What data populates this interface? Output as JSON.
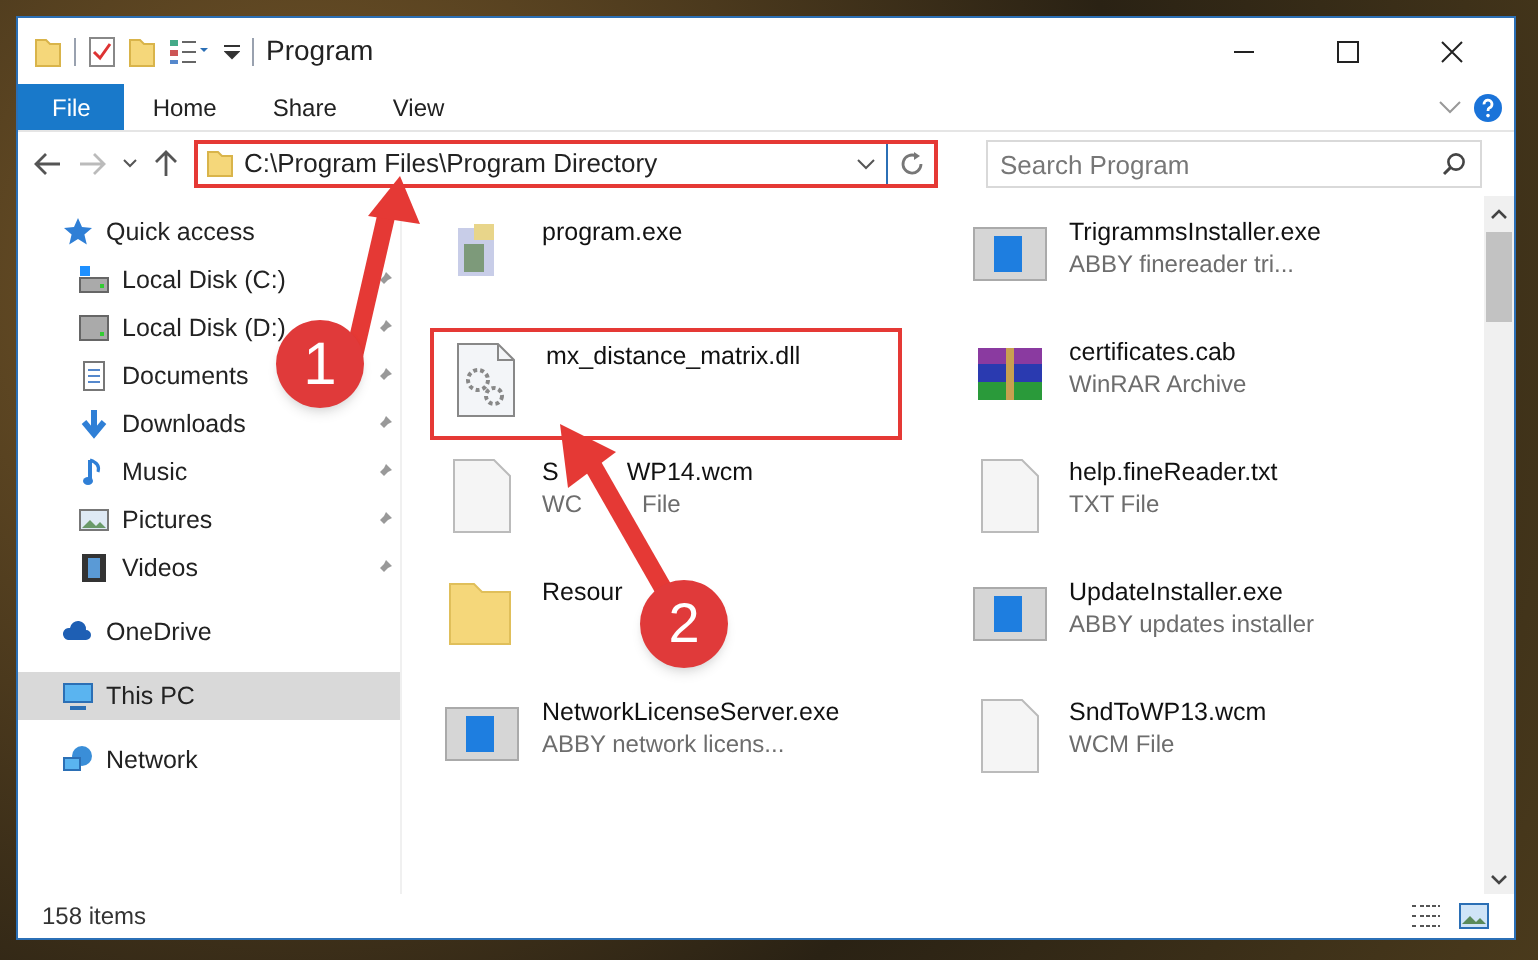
{
  "window": {
    "title": "Program"
  },
  "ribbon_tabs": [
    {
      "label": "File",
      "kind": "file"
    },
    {
      "label": "Home",
      "kind": "tab"
    },
    {
      "label": "Share",
      "kind": "tab"
    },
    {
      "label": "View",
      "kind": "tab"
    }
  ],
  "address_bar": {
    "path": "C:\\Program Files\\Program Directory",
    "highlighted": true
  },
  "search": {
    "placeholder": "Search Program"
  },
  "sidebar": {
    "items": [
      {
        "label": "Quick access",
        "kind": "quick",
        "selected": false,
        "children": [
          {
            "label": "Local Disk (C:)",
            "kind": "drive-c",
            "pinned": true,
            "selected": false
          },
          {
            "label": "Local Disk (D:)",
            "kind": "drive",
            "pinned": true,
            "selected": false
          },
          {
            "label": "Documents",
            "kind": "documents",
            "pinned": true,
            "selected": false
          },
          {
            "label": "Downloads",
            "kind": "downloads",
            "pinned": true,
            "selected": false
          },
          {
            "label": "Music",
            "kind": "music",
            "pinned": true,
            "selected": false
          },
          {
            "label": "Pictures",
            "kind": "pictures",
            "pinned": true,
            "selected": false
          },
          {
            "label": "Videos",
            "kind": "videos",
            "pinned": true,
            "selected": false
          }
        ]
      },
      {
        "label": "OneDrive",
        "kind": "cloud",
        "selected": false
      },
      {
        "label": "This PC",
        "kind": "pc",
        "selected": true
      },
      {
        "label": "Network",
        "kind": "network",
        "selected": false
      }
    ]
  },
  "files": [
    {
      "name": [
        "program.exe"
      ],
      "kind": "exe",
      "highlighted": false
    },
    {
      "name": [
        "TrigrammsInstaller.exe"
      ],
      "type": [
        "ABBY finereader tri..."
      ],
      "kind": "installer",
      "highlighted": false
    },
    {
      "name": [
        "mx_distance_matrix.dll"
      ],
      "kind": "dll",
      "highlighted": true
    },
    {
      "name": [
        "certificates.cab"
      ],
      "type": [
        "WinRAR Archive"
      ],
      "kind": "archive",
      "highlighted": false
    },
    {
      "name": [
        "S",
        "WP14.wcm"
      ],
      "type": [
        "WC",
        "File"
      ],
      "kind": "blank",
      "highlighted": false
    },
    {
      "name": [
        "help.fineReader.txt"
      ],
      "type": [
        "TXT File"
      ],
      "kind": "blank",
      "highlighted": false
    },
    {
      "name": [
        "Resour"
      ],
      "kind": "folder",
      "highlighted": false
    },
    {
      "name": [
        "UpdateInstaller.exe"
      ],
      "type": [
        "ABBY updates installer"
      ],
      "kind": "installer",
      "highlighted": false
    },
    {
      "name": [
        "NetworkLicenseServer.exe"
      ],
      "type": [
        "ABBY network licens..."
      ],
      "kind": "installer",
      "highlighted": false
    },
    {
      "name": [
        "SndToWP13.wcm"
      ],
      "type": [
        "WCM File"
      ],
      "kind": "blank",
      "highlighted": false
    }
  ],
  "status_bar": {
    "count": "158 items"
  },
  "steps": [
    {
      "label": "1"
    },
    {
      "label": "2"
    }
  ]
}
